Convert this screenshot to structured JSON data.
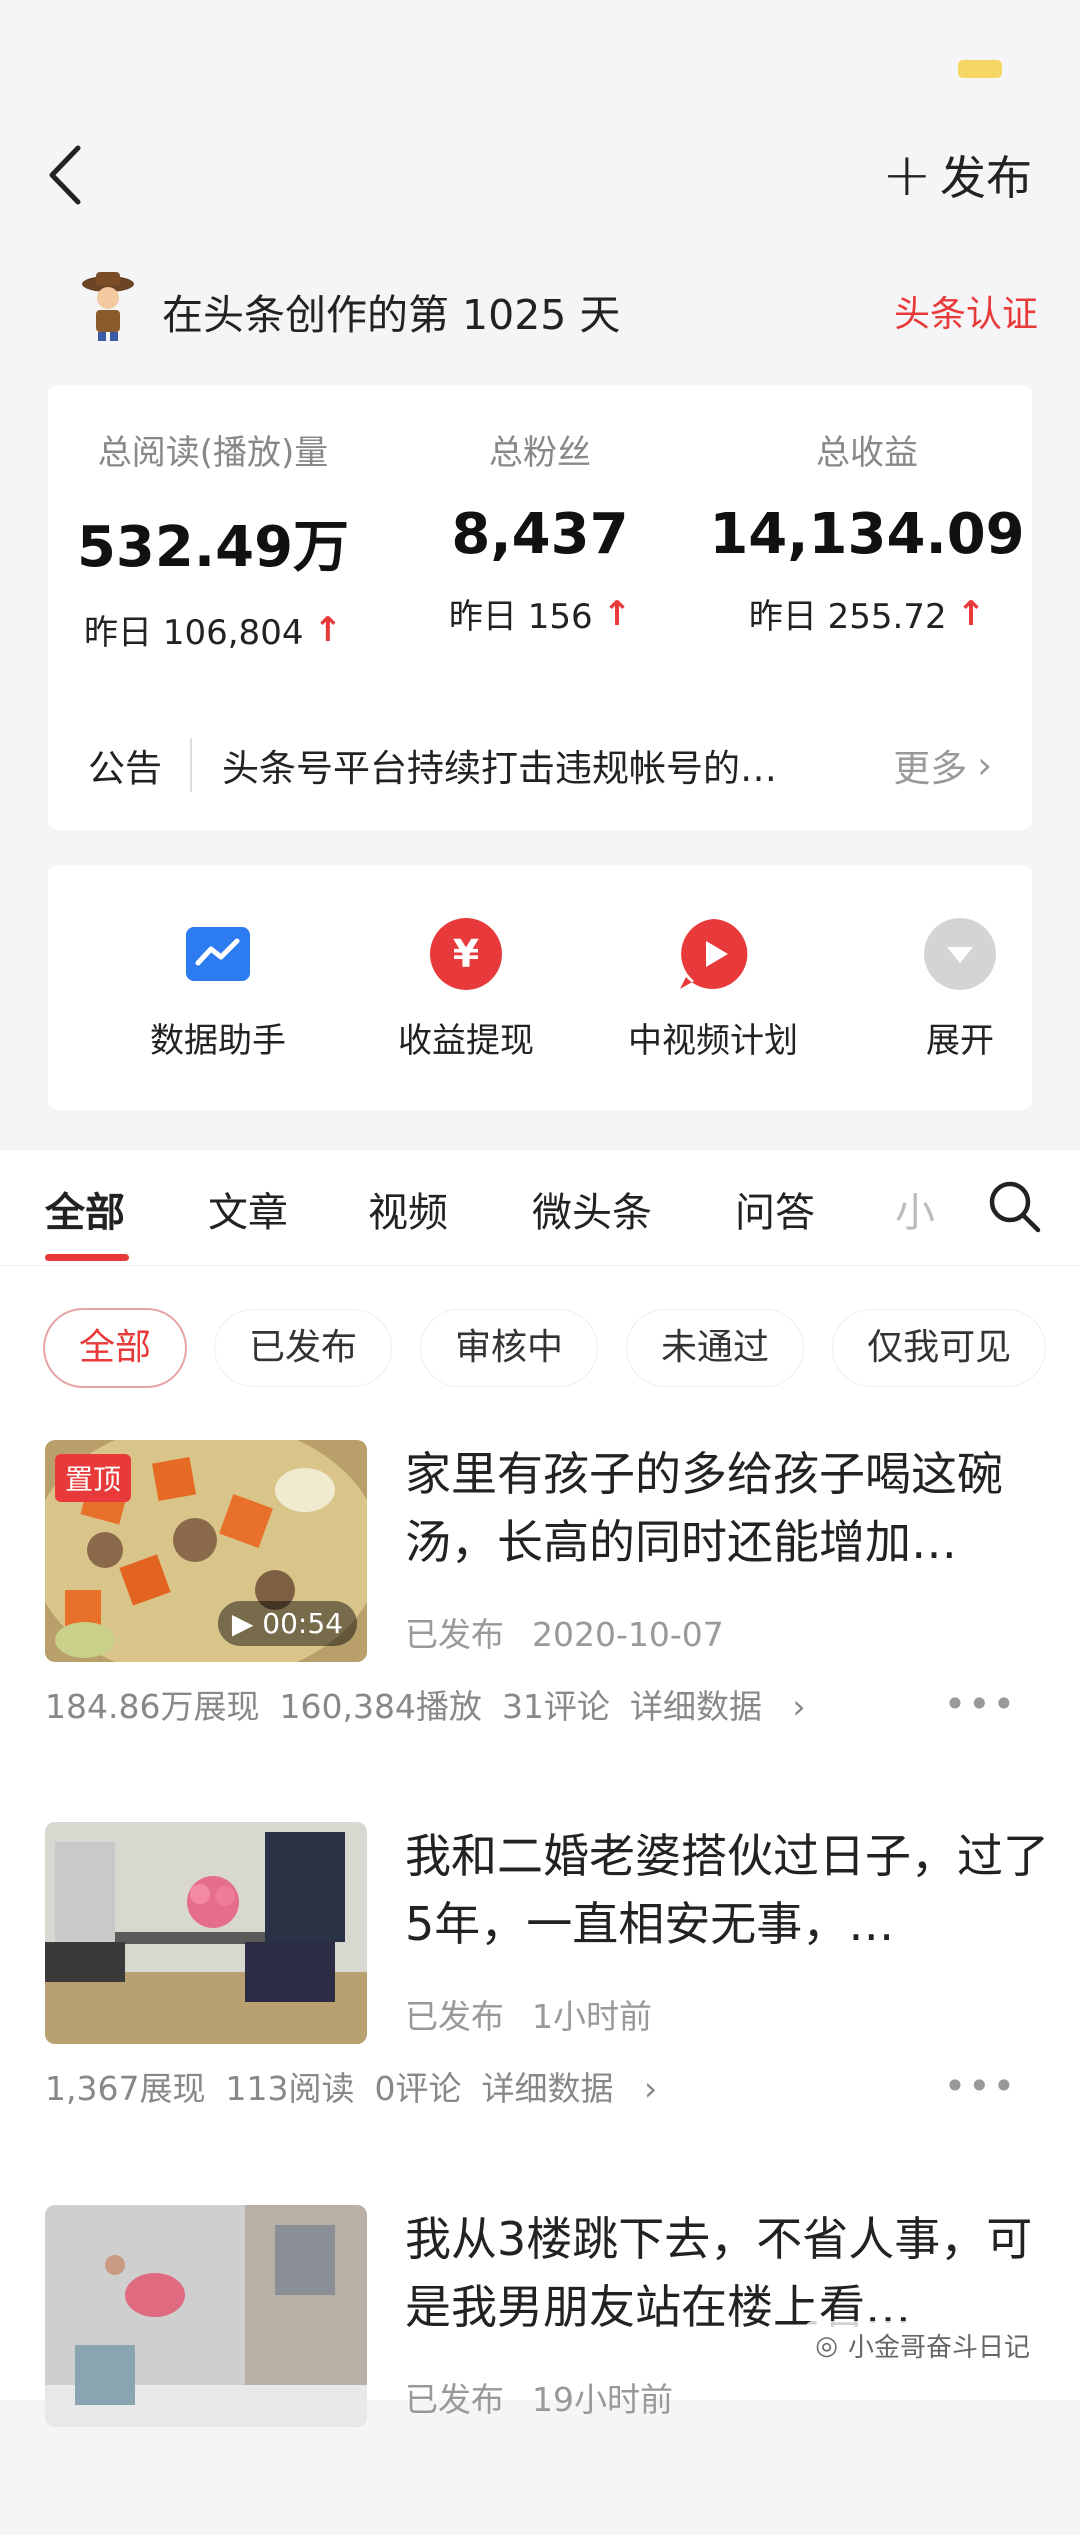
{
  "header": {
    "publish_label": "发布"
  },
  "creator": {
    "text": "在头条创作的第 1025 天",
    "verify": "头条认证"
  },
  "stats": [
    {
      "label": "总阅读(播放)量",
      "value": "532.49万",
      "yday": "昨日 106,804"
    },
    {
      "label": "总粉丝",
      "value": "8,437",
      "yday": "昨日 156"
    },
    {
      "label": "总收益",
      "value": "14,134.09",
      "yday": "昨日 255.72"
    }
  ],
  "notice": {
    "tag": "公告",
    "text": "头条号平台持续打击违规帐号的…",
    "more": "更多"
  },
  "tools": [
    {
      "label": "数据助手",
      "icon": "chart-icon"
    },
    {
      "label": "收益提现",
      "icon": "yuan-icon"
    },
    {
      "label": "中视频计划",
      "icon": "video-plan-icon"
    },
    {
      "label": "展开",
      "icon": "expand-icon"
    }
  ],
  "tabs": [
    "全部",
    "文章",
    "视频",
    "微头条",
    "问答",
    "小"
  ],
  "chips": [
    "全部",
    "已发布",
    "审核中",
    "未通过",
    "仅我可见"
  ],
  "articles": [
    {
      "pin": "置顶",
      "duration": "00:54",
      "title": "家里有孩子的多给孩子喝这碗汤，长高的同时还能增加…",
      "status": "已发布",
      "date": "2020-10-07",
      "stats": [
        "184.86万展现",
        "160,384播放",
        "31评论"
      ],
      "detail": "详细数据"
    },
    {
      "title": "我和二婚老婆搭伙过日子，过了5年，一直相安无事，…",
      "status": "已发布",
      "date": "1小时前",
      "stats": [
        "1,367展现",
        "113阅读",
        "0评论"
      ],
      "detail": "详细数据"
    },
    {
      "title": "我从3楼跳下去，不省人事，可是我男朋友站在楼上看…",
      "status": "已发布",
      "date": "19小时前"
    }
  ],
  "watermark": "小金哥奋斗日记",
  "colors": {
    "accent": "#e83a3a",
    "blue": "#2d7bf0"
  }
}
